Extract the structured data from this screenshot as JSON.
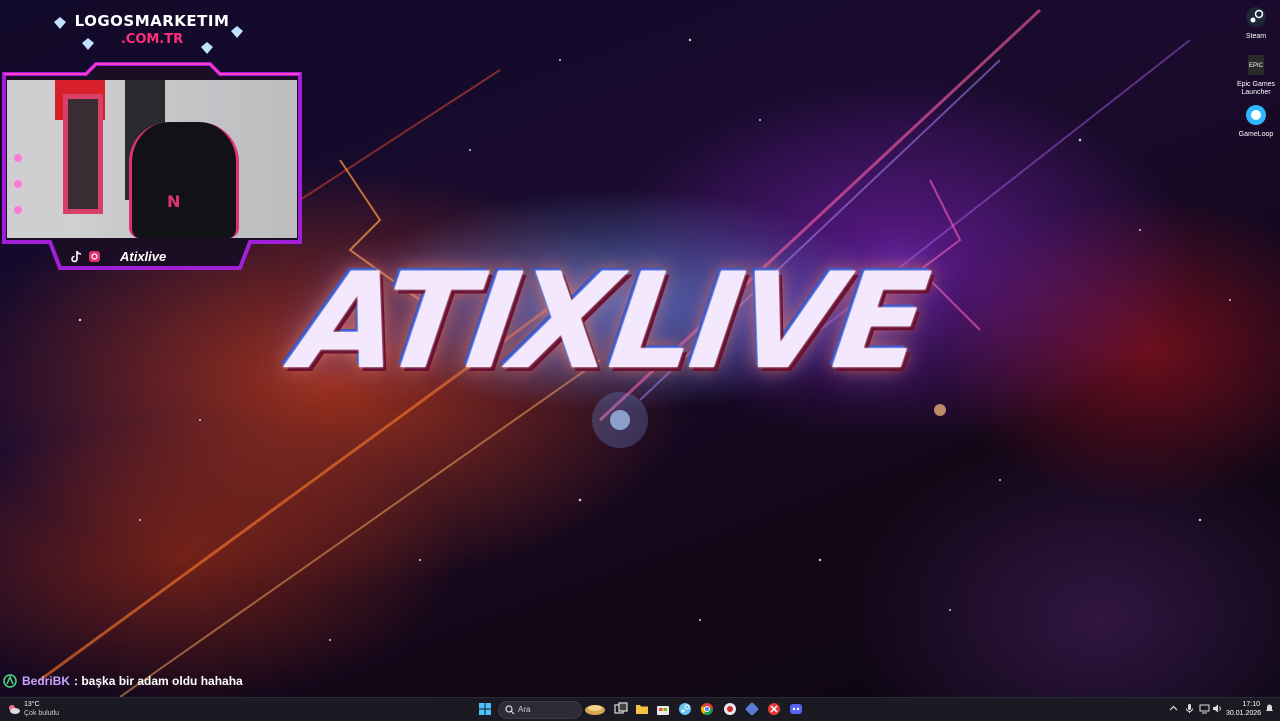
{
  "overlay": {
    "brand_name": "LOGOSMARKETIM",
    "brand_domain": ".COM.TR",
    "streamer_name": "Atixlive",
    "social_icons": [
      "tiktok-icon",
      "instagram-icon"
    ]
  },
  "wallpaper": {
    "logo_text": "ATIXLIVE"
  },
  "desktop": {
    "icons": [
      {
        "label": "Steam",
        "icon": "steam-icon"
      },
      {
        "label": "Epic Games Launcher",
        "icon": "epic-games-icon"
      },
      {
        "label": "GameLoop",
        "icon": "gameloop-icon"
      }
    ]
  },
  "chat": {
    "user": "BedriBK",
    "message": ": başka bir adam oldu hahaha"
  },
  "taskbar": {
    "weather_temp": "13°C",
    "weather_desc": "Çok bulutlu",
    "search_placeholder": "Ara",
    "pinned_apps": [
      "start-icon",
      "search-icon",
      "task-view-icon",
      "file-explorer-icon",
      "store-icon",
      "steam-icon",
      "chrome-icon",
      "recording-icon",
      "game-icon",
      "app-icon",
      "discord-icon"
    ],
    "time": "17:10",
    "date": "30.01.2026"
  },
  "colors": {
    "accent_purple": "#a020d8",
    "brand_pink": "#ff2f7a",
    "chat_user": "#c7a6ff"
  }
}
